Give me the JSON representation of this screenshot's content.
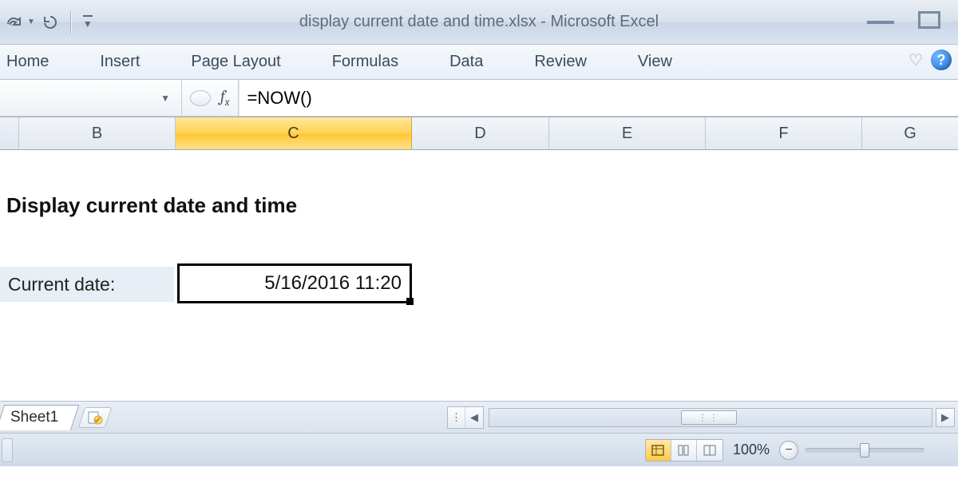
{
  "title": {
    "filename": "display current date and time.xlsx",
    "separator": " - ",
    "app": "Microsoft Excel"
  },
  "ribbon": {
    "tabs": [
      "Home",
      "Insert",
      "Page Layout",
      "Formulas",
      "Data",
      "Review",
      "View"
    ]
  },
  "formula_bar": {
    "fx_label": "f",
    "fx_sub": "x",
    "value": "=NOW()"
  },
  "columns": [
    "B",
    "C",
    "D",
    "E",
    "F",
    "G"
  ],
  "active_column": "C",
  "content": {
    "heading": "Display current date and time",
    "label": "Current date:",
    "cell_value": "5/16/2016 11:20"
  },
  "sheet": {
    "name": "Sheet1"
  },
  "statusbar": {
    "zoom": "100%"
  }
}
